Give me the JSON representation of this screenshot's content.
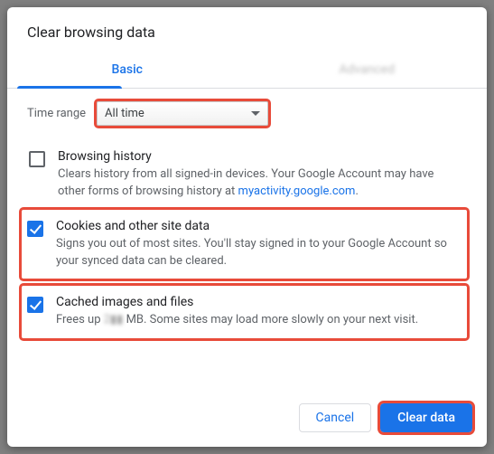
{
  "dialog": {
    "title": "Clear browsing data",
    "tabs": {
      "basic": "Basic",
      "advanced": "Advanced"
    },
    "timeRange": {
      "label": "Time range",
      "value": "All time"
    },
    "options": {
      "history": {
        "title": "Browsing history",
        "desc_pre": "Clears history from all signed-in devices. Your Google Account may have other forms of browsing history at ",
        "link": "myactivity.google.com",
        "desc_post": ".",
        "checked": false
      },
      "cookies": {
        "title": "Cookies and other site data",
        "desc": "Signs you out of most sites. You'll stay signed in to your Google Account so your synced data can be cleared.",
        "checked": true
      },
      "cache": {
        "title": "Cached images and files",
        "desc_pre": "Frees up ",
        "size": "2▮▮",
        "desc_post": " MB. Some sites may load more slowly on your next visit.",
        "checked": true
      }
    },
    "buttons": {
      "cancel": "Cancel",
      "clear": "Clear data"
    }
  }
}
